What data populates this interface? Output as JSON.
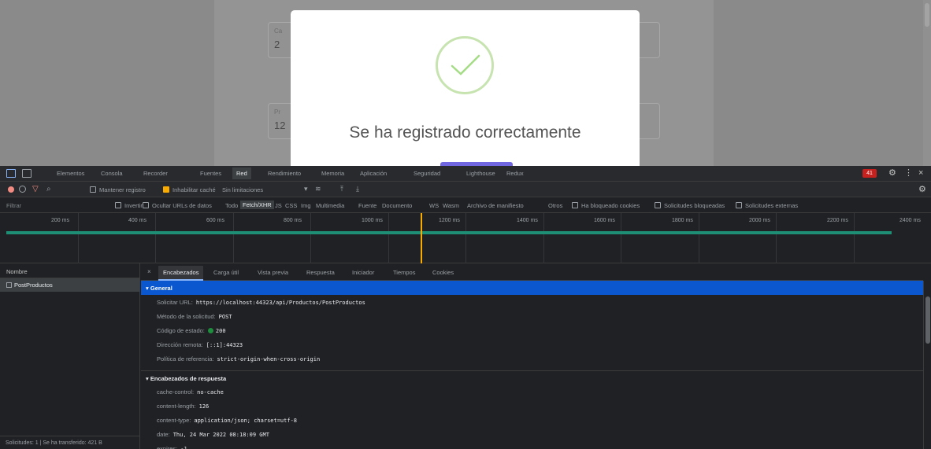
{
  "page": {
    "fields": [
      {
        "label": "Ca",
        "value": "2"
      },
      {
        "label": "Pr",
        "value": "12"
      }
    ]
  },
  "modal": {
    "message": "Se ha registrado correctamente",
    "success_color": "#a5dc86",
    "button_color": "#7066e0"
  },
  "devtools": {
    "tabs": [
      "Elementos",
      "Consola",
      "Recorder",
      "Fuentes",
      "Red",
      "Rendimiento",
      "Memoria",
      "Aplicación",
      "Seguridad",
      "Lighthouse",
      "Redux"
    ],
    "active_tab": "Red",
    "issues_count": "41",
    "toolbar": {
      "preserve_log": "Mantener registro",
      "disable_cache": "Inhabilitar caché",
      "throttle": "Sin limitaciones"
    },
    "filter": {
      "placeholder": "Filtrar",
      "invert": "Invertir",
      "hide_data_urls": "Ocultar URLs de datos",
      "types": [
        "Todo",
        "Fetch/XHR",
        "JS",
        "CSS",
        "Img",
        "Multimedia",
        "Fuente",
        "Documento",
        "WS",
        "Wasm",
        "Archivo de manifiesto",
        "Otros"
      ],
      "active_type": "Fetch/XHR",
      "blocked_cookies": "Ha bloqueado cookies",
      "blocked_requests": "Solicitudes bloqueadas",
      "third_party": "Solicitudes externas"
    },
    "timeline_ticks": [
      "200 ms",
      "400 ms",
      "600 ms",
      "800 ms",
      "1000 ms",
      "1200 ms",
      "1400 ms",
      "1600 ms",
      "1800 ms",
      "2000 ms",
      "2200 ms",
      "2400 ms"
    ],
    "request_list": {
      "header": "Nombre",
      "rows": [
        "PostProductos"
      ],
      "footer": "Solicitudes: 1 | Se ha transferido: 421 B"
    },
    "detail_tabs": [
      "Encabezados",
      "Carga útil",
      "Vista previa",
      "Respuesta",
      "Iniciador",
      "Tiempos",
      "Cookies"
    ],
    "active_detail_tab": "Encabezados",
    "general": {
      "title": "General",
      "rows": [
        {
          "key": "Solicitar URL:",
          "value": "https://localhost:44323/api/Productos/PostProductos"
        },
        {
          "key": "Método de la solicitud:",
          "value": "POST"
        },
        {
          "key": "Código de estado:",
          "value": "200"
        },
        {
          "key": "Dirección remota:",
          "value": "[::1]:44323"
        },
        {
          "key": "Política de referencia:",
          "value": "strict-origin-when-cross-origin"
        }
      ]
    },
    "response_headers": {
      "title": "Encabezados de respuesta",
      "rows": [
        {
          "key": "cache-control:",
          "value": "no-cache"
        },
        {
          "key": "content-length:",
          "value": "126"
        },
        {
          "key": "content-type:",
          "value": "application/json; charset=utf-8"
        },
        {
          "key": "date:",
          "value": "Thu, 24 Mar 2022 08:18:09 GMT"
        },
        {
          "key": "expires:",
          "value": "-1"
        }
      ]
    }
  }
}
